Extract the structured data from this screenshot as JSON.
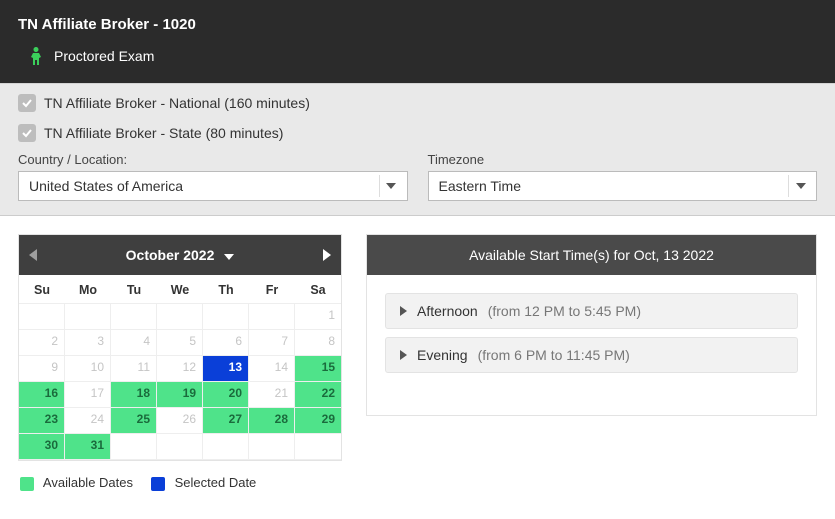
{
  "header": {
    "title": "TN Affiliate Broker - 1020",
    "subtitle": "Proctored Exam"
  },
  "exams": [
    {
      "label": "TN Affiliate Broker - National (160 minutes)"
    },
    {
      "label": "TN Affiliate Broker - State (80 minutes)"
    }
  ],
  "selectors": {
    "country_label": "Country / Location:",
    "country_value": "United States of America",
    "timezone_label": "Timezone",
    "timezone_value": "Eastern Time"
  },
  "calendar": {
    "month_label": "October 2022",
    "days_of_week": [
      "Su",
      "Mo",
      "Tu",
      "We",
      "Th",
      "Fr",
      "Sa"
    ],
    "cells": [
      {
        "state": "empty"
      },
      {
        "state": "empty"
      },
      {
        "state": "empty"
      },
      {
        "state": "empty"
      },
      {
        "state": "empty"
      },
      {
        "state": "empty"
      },
      {
        "day": 1,
        "state": "disabled"
      },
      {
        "day": 2,
        "state": "disabled"
      },
      {
        "day": 3,
        "state": "disabled"
      },
      {
        "day": 4,
        "state": "disabled"
      },
      {
        "day": 5,
        "state": "disabled"
      },
      {
        "day": 6,
        "state": "disabled"
      },
      {
        "day": 7,
        "state": "disabled"
      },
      {
        "day": 8,
        "state": "disabled"
      },
      {
        "day": 9,
        "state": "disabled"
      },
      {
        "day": 10,
        "state": "disabled"
      },
      {
        "day": 11,
        "state": "disabled"
      },
      {
        "day": 12,
        "state": "disabled"
      },
      {
        "day": 13,
        "state": "selected"
      },
      {
        "day": 14,
        "state": "disabled"
      },
      {
        "day": 15,
        "state": "available"
      },
      {
        "day": 16,
        "state": "available"
      },
      {
        "day": 17,
        "state": "disabled"
      },
      {
        "day": 18,
        "state": "available"
      },
      {
        "day": 19,
        "state": "available"
      },
      {
        "day": 20,
        "state": "available"
      },
      {
        "day": 21,
        "state": "disabled"
      },
      {
        "day": 22,
        "state": "available"
      },
      {
        "day": 23,
        "state": "available"
      },
      {
        "day": 24,
        "state": "disabled"
      },
      {
        "day": 25,
        "state": "available"
      },
      {
        "day": 26,
        "state": "disabled"
      },
      {
        "day": 27,
        "state": "available"
      },
      {
        "day": 28,
        "state": "available"
      },
      {
        "day": 29,
        "state": "available"
      },
      {
        "day": 30,
        "state": "available"
      },
      {
        "day": 31,
        "state": "available"
      },
      {
        "state": "empty"
      },
      {
        "state": "empty"
      },
      {
        "state": "empty"
      },
      {
        "state": "empty"
      },
      {
        "state": "empty"
      }
    ]
  },
  "legend": {
    "available": "Available Dates",
    "selected": "Selected Date"
  },
  "times": {
    "header": "Available Start Time(s) for Oct, 13 2022",
    "slots": [
      {
        "label": "Afternoon",
        "range": " (from 12 PM to 5:45 PM)"
      },
      {
        "label": "Evening",
        "range": " (from 6 PM to 11:45 PM)"
      }
    ]
  }
}
